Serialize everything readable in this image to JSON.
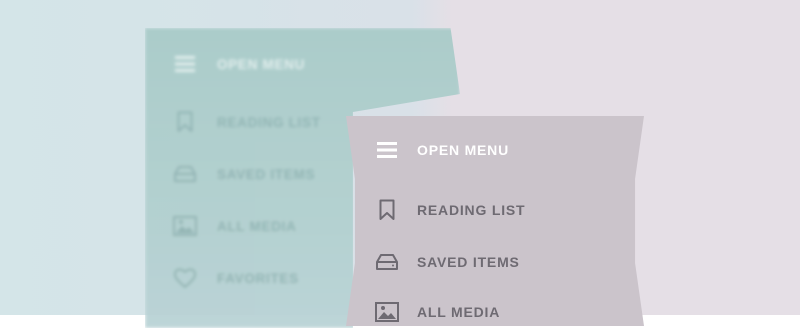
{
  "colors": {
    "bg_left": "#d4e5e8",
    "bg_right": "#e5dfe6",
    "back_panel": "#a9cbc9",
    "front_panel": "#cbc4cb",
    "front_text": "#6e6a72",
    "header_text": "#ffffff"
  },
  "background_menu": {
    "header_label": "OPEN MENU",
    "header_icon": "hamburger-icon",
    "items": [
      {
        "label": "READING LIST",
        "icon": "bookmark-icon"
      },
      {
        "label": "SAVED ITEMS",
        "icon": "drive-icon"
      },
      {
        "label": "ALL MEDIA",
        "icon": "image-icon"
      },
      {
        "label": "FAVORITES",
        "icon": "heart-icon"
      }
    ]
  },
  "foreground_menu": {
    "header_label": "OPEN MENU",
    "header_icon": "hamburger-icon",
    "items": [
      {
        "label": "READING LIST",
        "icon": "bookmark-icon"
      },
      {
        "label": "SAVED ITEMS",
        "icon": "drive-icon"
      },
      {
        "label": "ALL MEDIA",
        "icon": "image-icon"
      }
    ]
  }
}
